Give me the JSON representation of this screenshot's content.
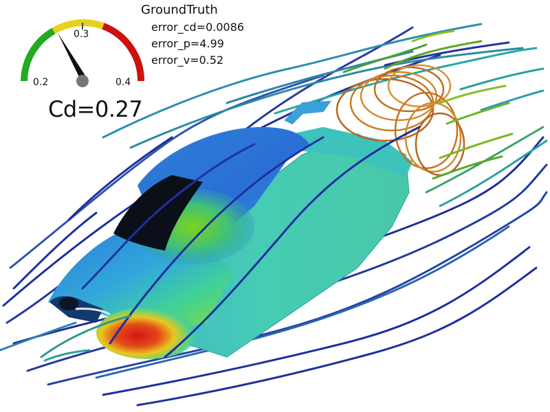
{
  "legend": {
    "title": "GroundTruth",
    "error_cd": "error_cd=0.0086",
    "error_p": "error_p=4.99",
    "error_v": "error_v=0.52"
  },
  "gauge": {
    "tick_low": "0.2",
    "tick_mid": "0.3",
    "tick_high": "0.4",
    "readout": "Cd=0.27",
    "value": 0.27,
    "min": 0.2,
    "max": 0.4,
    "zone_colors": [
      "#22aa22",
      "#e6d21e",
      "#cc1111"
    ]
  },
  "colors": {
    "streamline_cold": "#1a2a9a",
    "streamline_mid": "#2aa0a0",
    "streamline_warm": "#c87a1e",
    "car_body": "#2e86d8",
    "car_side": "#3cc7b0",
    "high_pressure": "#d81e1e"
  }
}
